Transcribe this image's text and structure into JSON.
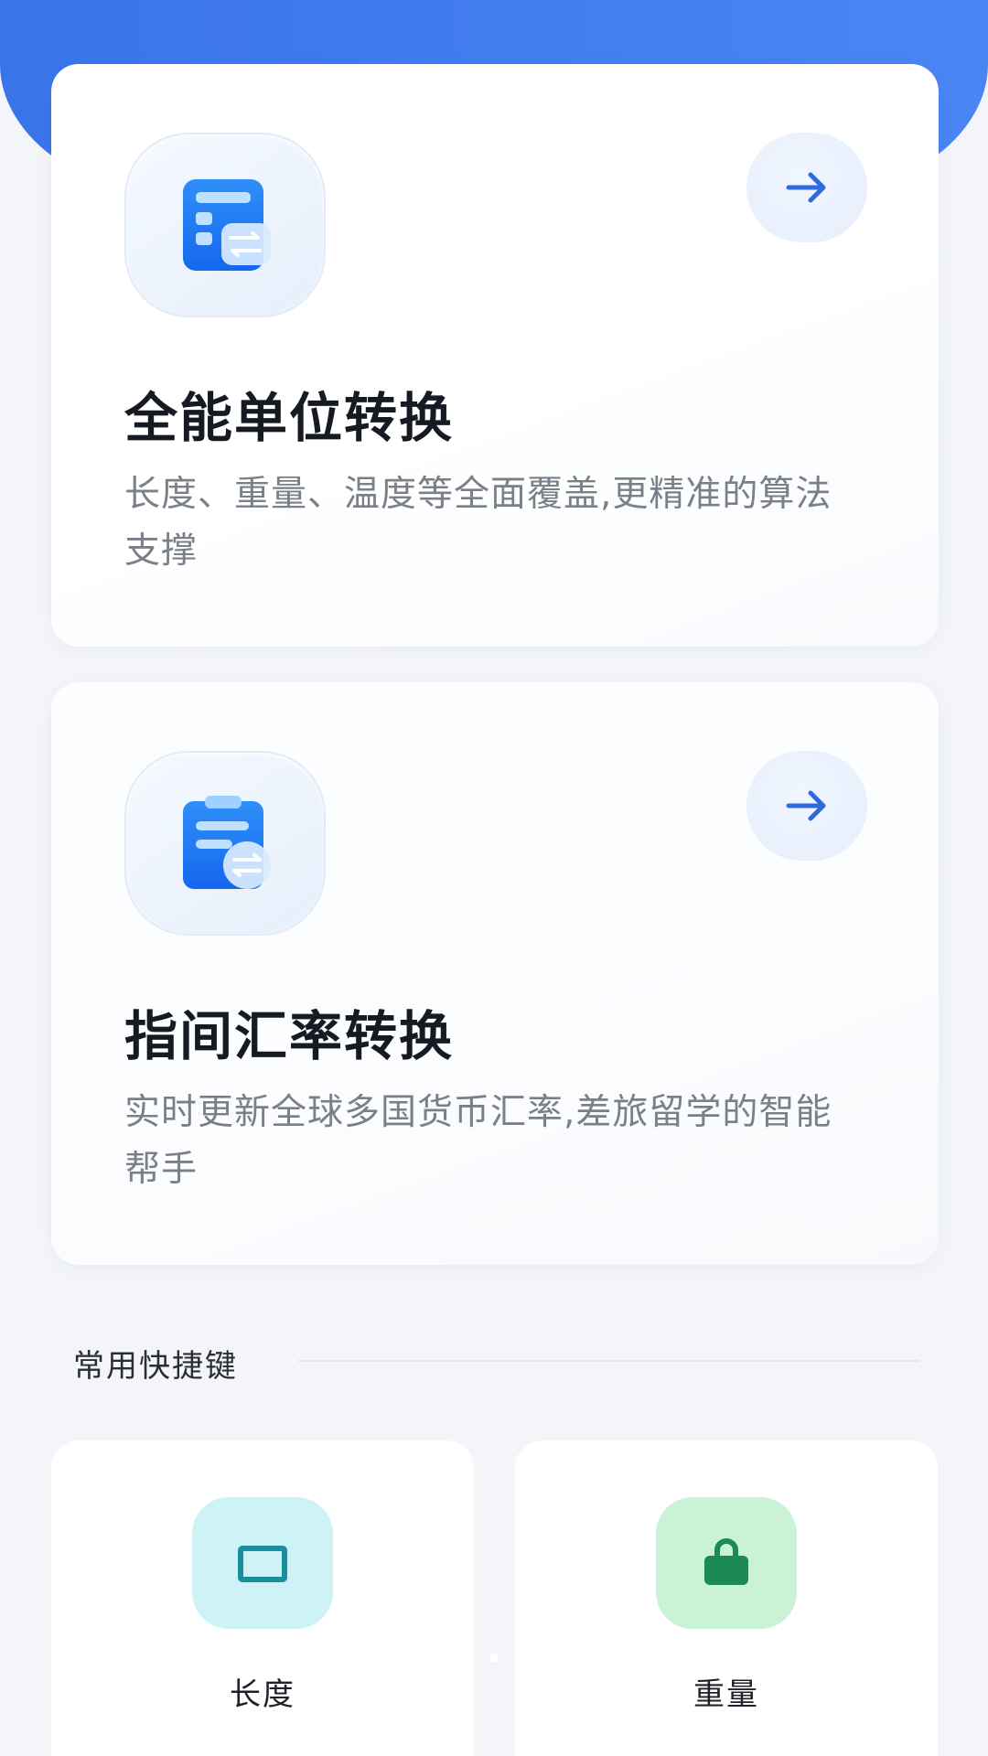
{
  "header": {
    "banner_color": "#3a74ea"
  },
  "feature_cards": [
    {
      "icon": "calculator-convert-icon",
      "title": "全能单位转换",
      "description": "长度、重量、温度等全面覆盖,更精准的算法支撑",
      "action_icon": "arrow-right-icon"
    },
    {
      "icon": "clipboard-convert-icon",
      "title": "指间汇率转换",
      "description": "实时更新全球多国货币汇率,差旅留学的智能帮手",
      "action_icon": "arrow-right-icon"
    }
  ],
  "shortcuts_section": {
    "title": "常用快捷键",
    "items": [
      {
        "label": "长度",
        "icon": "ruler-rectangle-icon",
        "color": "#cdf3f6"
      },
      {
        "label": "重量",
        "icon": "weight-icon",
        "color": "#c9f2d7"
      }
    ]
  },
  "colors": {
    "accent_blue": "#1677f5",
    "arrow_blue": "#2f6bdc",
    "length_icon": "#1a8f9c",
    "weight_icon": "#1b8a56"
  }
}
